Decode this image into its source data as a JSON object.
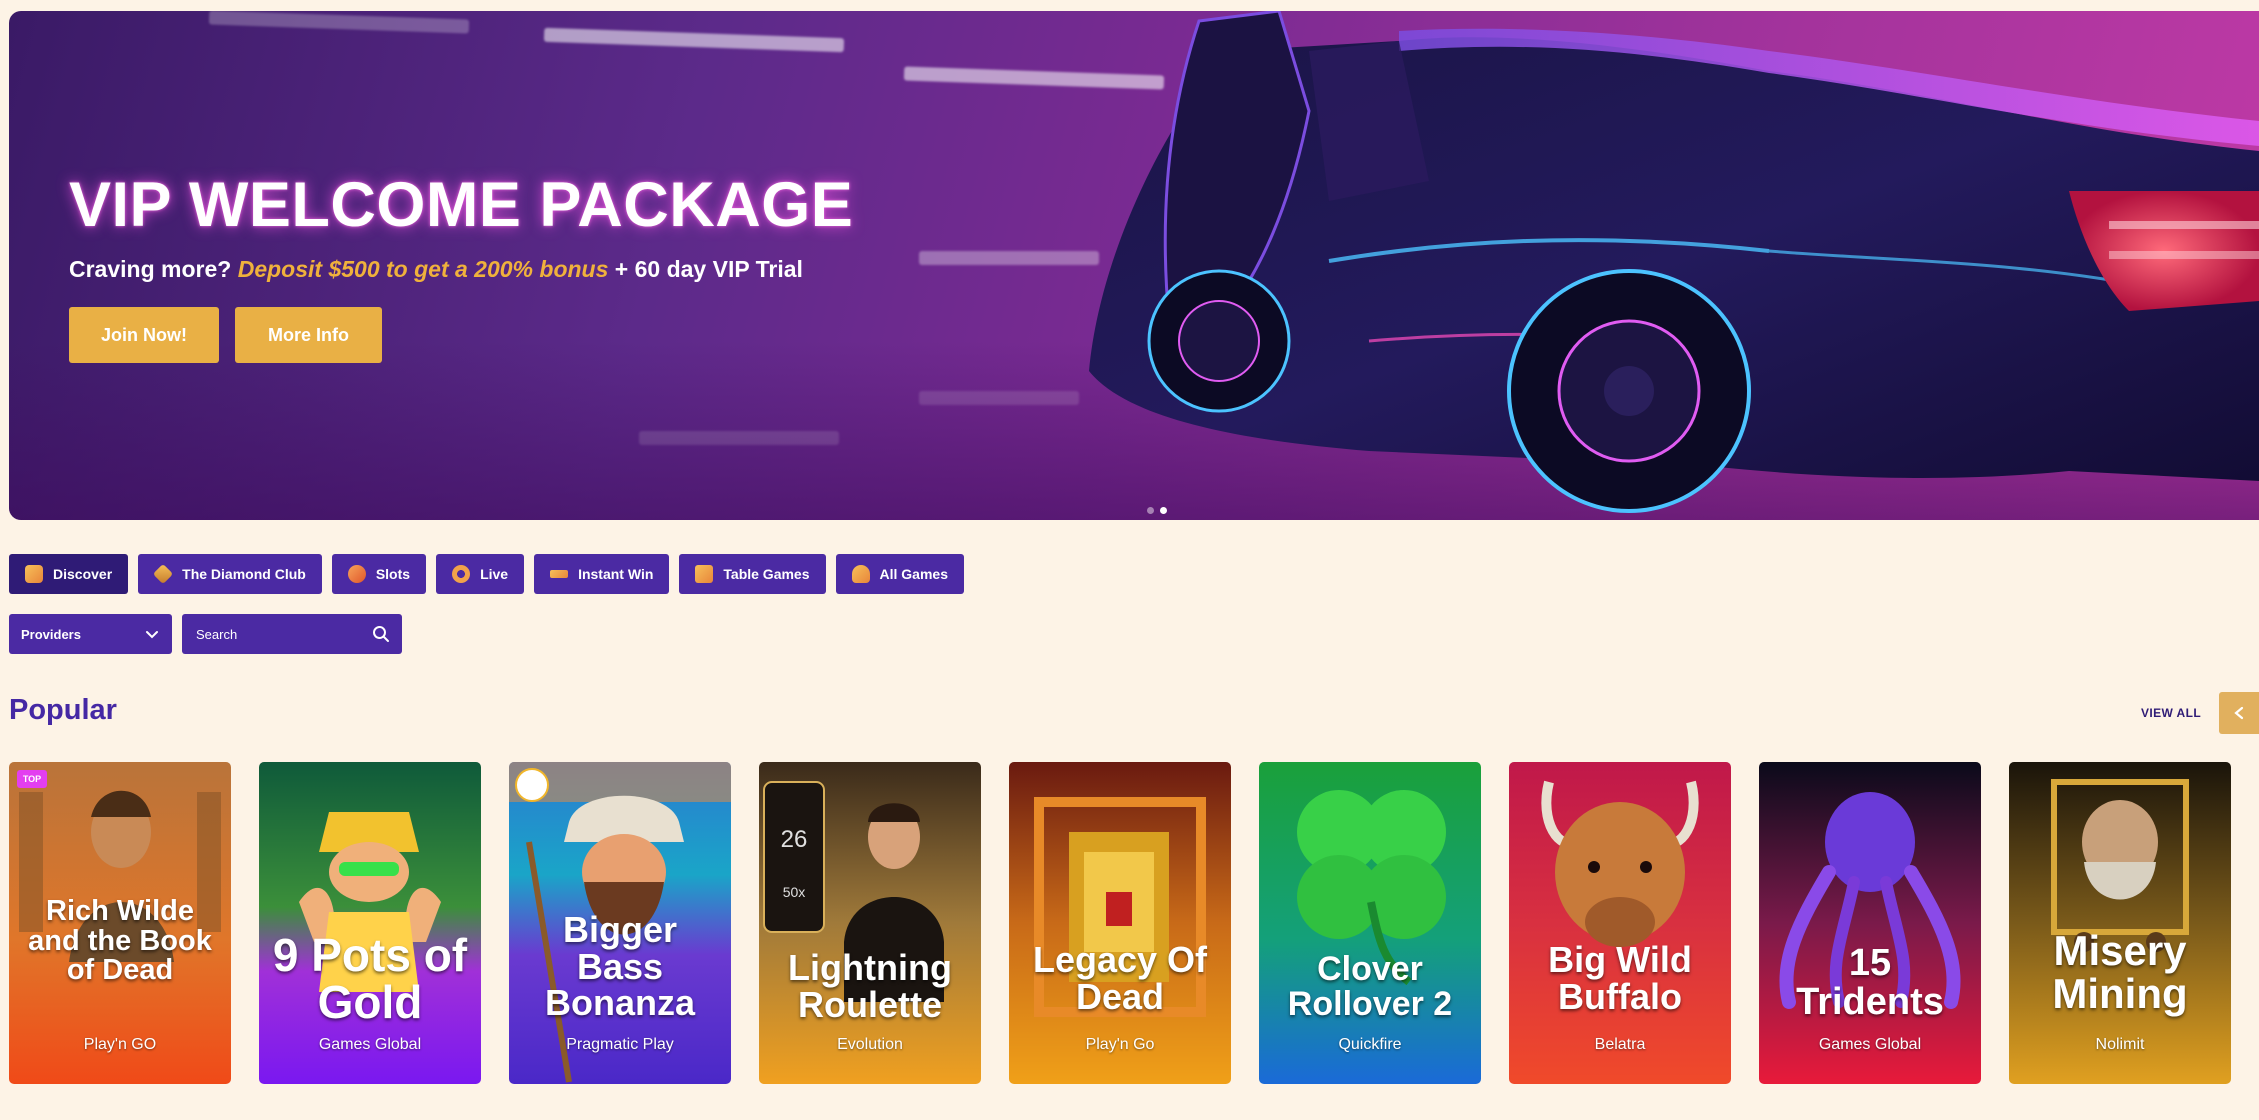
{
  "hero": {
    "title": "VIP WELCOME PACKAGE",
    "subtitle_prefix": "Craving more? ",
    "subtitle_highlight": "Deposit $500 to get a 200% bonus",
    "subtitle_suffix": " + 60 day VIP Trial",
    "join_label": "Join Now!",
    "more_label": "More Info",
    "slide_count": 2,
    "active_slide": 2
  },
  "tabs": [
    {
      "label": "Discover",
      "icon": "discover-icon",
      "active": true
    },
    {
      "label": "The Diamond Club",
      "icon": "diamond-icon",
      "active": false
    },
    {
      "label": "Slots",
      "icon": "slots-icon",
      "active": false
    },
    {
      "label": "Live",
      "icon": "live-icon",
      "active": false
    },
    {
      "label": "Instant Win",
      "icon": "instant-win-icon",
      "active": false
    },
    {
      "label": "Table Games",
      "icon": "table-games-icon",
      "active": false
    },
    {
      "label": "All Games",
      "icon": "all-games-icon",
      "active": false
    }
  ],
  "filters": {
    "providers_label": "Providers",
    "search_placeholder": "Search"
  },
  "popular": {
    "title": "Popular",
    "view_all": "VIEW ALL"
  },
  "games": [
    {
      "title": "Rich Wilde and the Book of Dead",
      "provider": "Play'n GO",
      "badge": "TOP"
    },
    {
      "title": "9 Pots of Gold",
      "provider": "Games Global"
    },
    {
      "title": "Bigger Bass Bonanza",
      "provider": "Pragmatic Play"
    },
    {
      "title": "Lightning Roulette",
      "provider": "Evolution"
    },
    {
      "title": "Legacy Of Dead",
      "provider": "Play'n Go"
    },
    {
      "title": "Clover Rollover 2",
      "provider": "Quickfire"
    },
    {
      "title": "Big Wild Buffalo",
      "provider": "Belatra"
    },
    {
      "title": "15 Tridents",
      "provider": "Games Global"
    },
    {
      "title": "Misery Mining",
      "provider": "Nolimit"
    }
  ],
  "colors": {
    "page_bg": "#fdf3e6",
    "accent_purple": "#4b2aa3",
    "active_tab": "#2f1b76",
    "gold": "#e9b045"
  }
}
